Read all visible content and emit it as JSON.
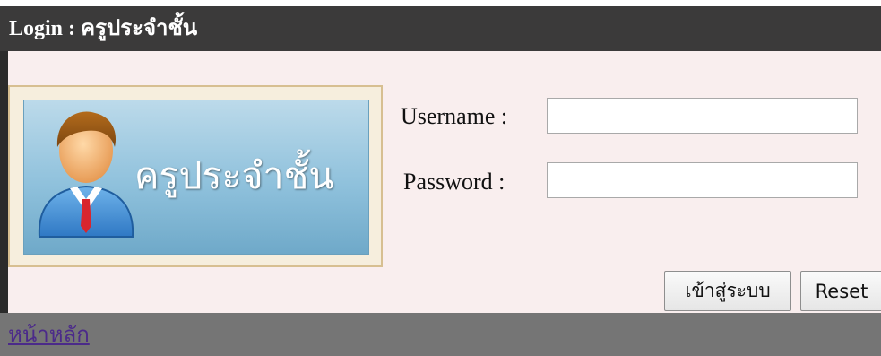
{
  "header": {
    "title": "Login : ครูประจำชั้น"
  },
  "banner": {
    "text": "ครูประจำชั้น",
    "icon": "teacher-avatar-icon"
  },
  "form": {
    "username_label": "Username :",
    "username_value": "",
    "password_label": "Password :",
    "password_value": ""
  },
  "buttons": {
    "login_label": "เข้าสู่ระบบ",
    "reset_label": "Reset"
  },
  "footer": {
    "home_link": "หน้าหลัก"
  },
  "colors": {
    "header_bg": "#3b3a3a",
    "panel_bg": "#f9eeee",
    "footer_bg": "#757575",
    "link": "#4b2a8a",
    "banner_blue": "#8fc1dc"
  }
}
